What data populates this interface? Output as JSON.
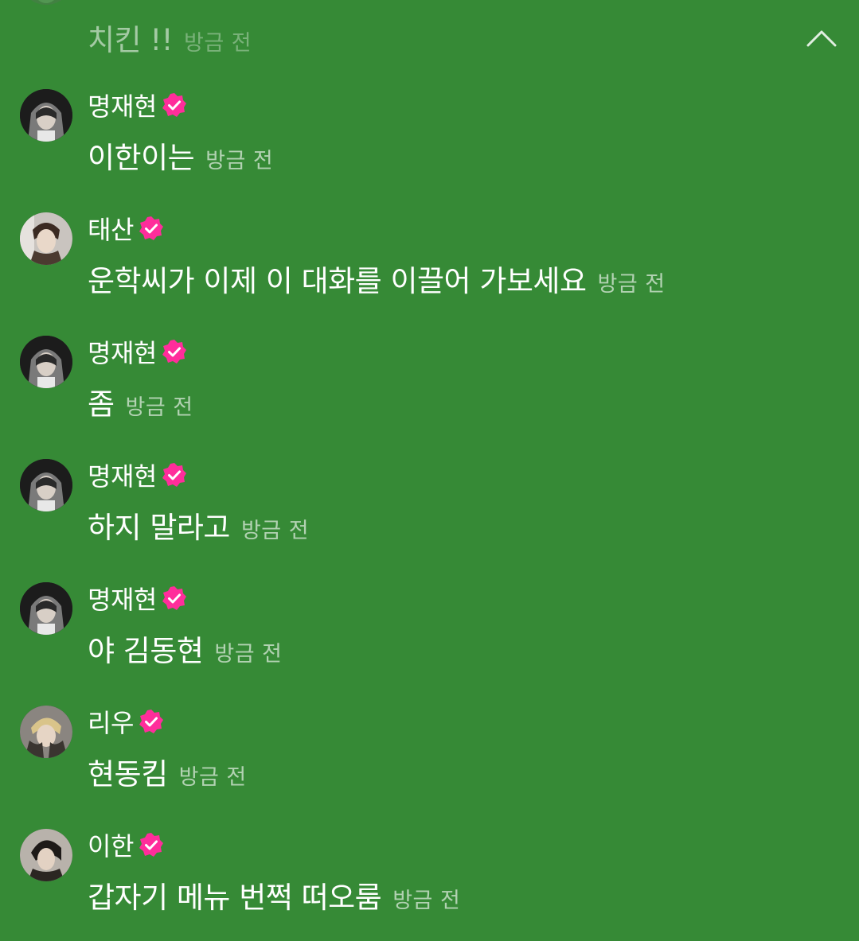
{
  "header": {
    "collapse_icon": "chevron-up-icon"
  },
  "partial_message": {
    "text": "치킨 !!",
    "time": "방금 전"
  },
  "messages": [
    {
      "user": "명재현",
      "verified": true,
      "text": "이한이는",
      "time": "방금 전"
    },
    {
      "user": "태산",
      "verified": true,
      "text": "운학씨가 이제 이 대화를 이끌어 가보세요",
      "time": "방금 전"
    },
    {
      "user": "명재현",
      "verified": true,
      "text": "좀",
      "time": "방금 전"
    },
    {
      "user": "명재현",
      "verified": true,
      "text": "하지 말라고",
      "time": "방금 전"
    },
    {
      "user": "명재현",
      "verified": true,
      "text": "야 김동현",
      "time": "방금 전"
    },
    {
      "user": "리우",
      "verified": true,
      "text": "현동킴",
      "time": "방금 전"
    },
    {
      "user": "이한",
      "verified": true,
      "text": "갑자기 메뉴 번쩍 떠오룸",
      "time": "방금 전"
    }
  ],
  "colors": {
    "background": "#368a36",
    "verified_badge": "#ff2d9b",
    "text": "#ffffff"
  }
}
